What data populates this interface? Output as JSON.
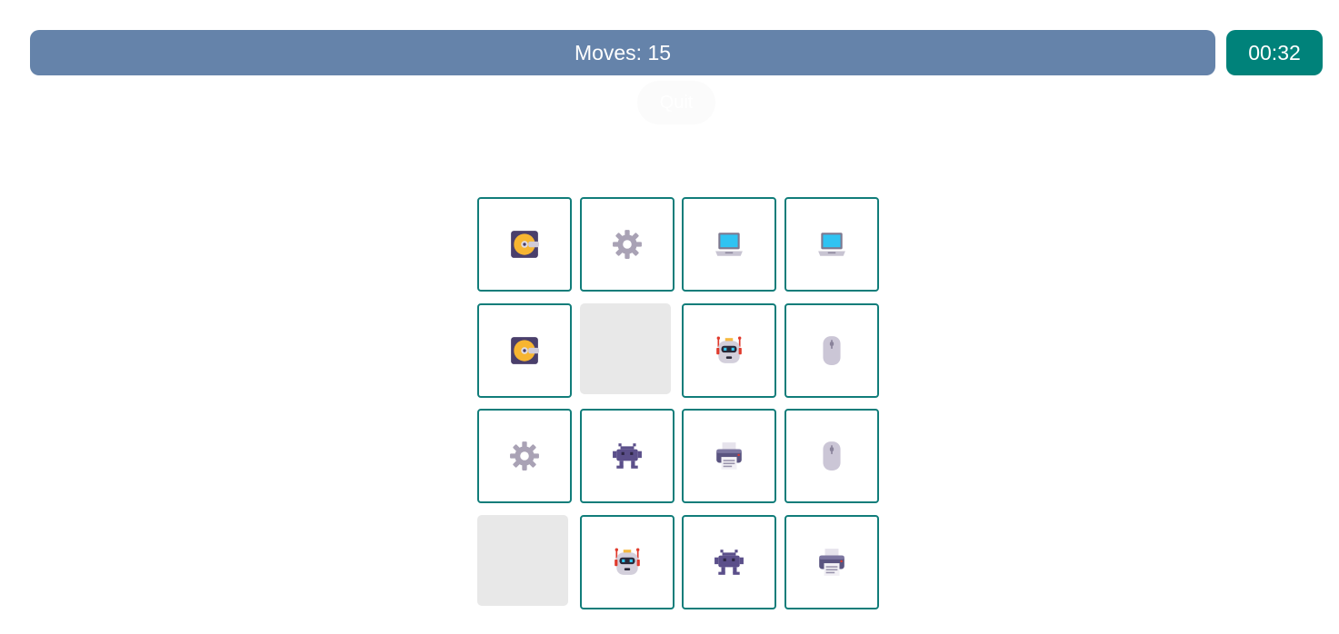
{
  "header": {
    "moves_label": "Moves: 15",
    "timer": "00:32",
    "quit_label": "Quit"
  },
  "board": {
    "rows": 4,
    "cols": 4,
    "cards": [
      {
        "icon": "disk-icon",
        "face_up": true
      },
      {
        "icon": "gear-icon",
        "face_up": true
      },
      {
        "icon": "laptop-icon",
        "face_up": true
      },
      {
        "icon": "laptop-icon",
        "face_up": true
      },
      {
        "icon": "disk-icon",
        "face_up": true
      },
      {
        "icon": "",
        "face_up": false
      },
      {
        "icon": "robot-icon",
        "face_up": true
      },
      {
        "icon": "mouse-icon",
        "face_up": true
      },
      {
        "icon": "gear-icon",
        "face_up": true
      },
      {
        "icon": "alien-icon",
        "face_up": true
      },
      {
        "icon": "printer-icon",
        "face_up": true
      },
      {
        "icon": "mouse-icon",
        "face_up": true
      },
      {
        "icon": "",
        "face_up": false
      },
      {
        "icon": "robot-icon",
        "face_up": true
      },
      {
        "icon": "alien-icon",
        "face_up": true
      },
      {
        "icon": "printer-icon",
        "face_up": true
      }
    ]
  },
  "colors": {
    "moves_bar": "#6583aa",
    "timer_bg": "#00827a",
    "card_border": "#117d7a",
    "hidden_card": "#e8e8e8"
  }
}
